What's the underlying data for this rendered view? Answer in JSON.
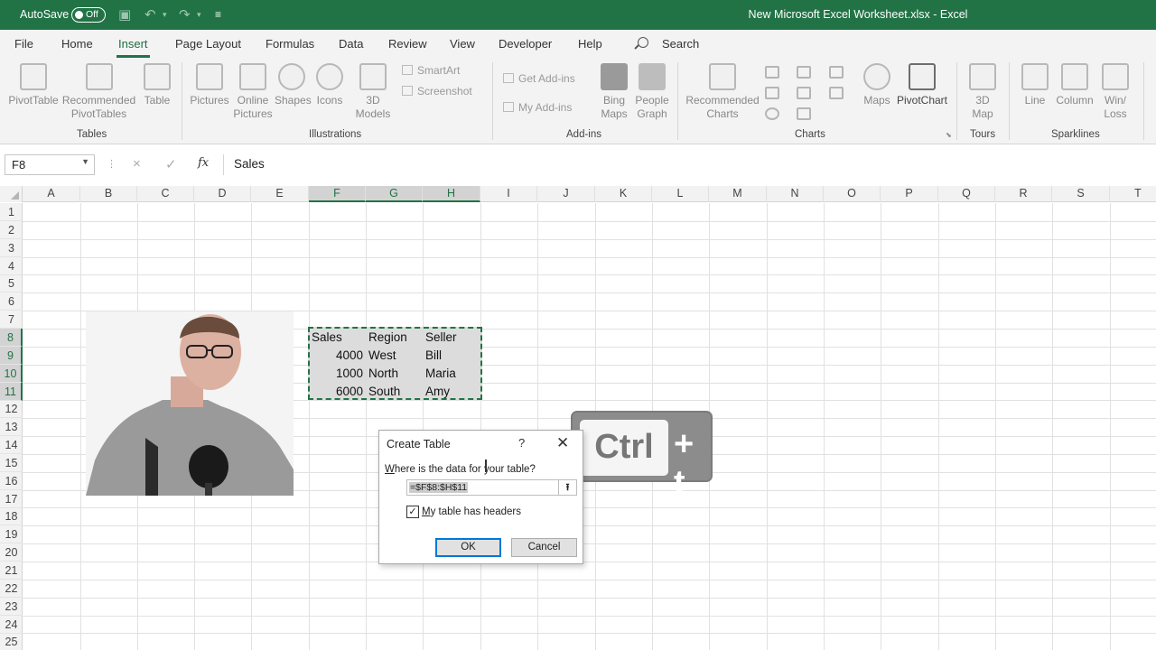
{
  "titlebar": {
    "autosave_label": "AutoSave",
    "autosave_state": "Off",
    "doc_title": "New Microsoft Excel Worksheet.xlsx  -  Excel"
  },
  "tabs": [
    "File",
    "Home",
    "Insert",
    "Page Layout",
    "Formulas",
    "Data",
    "Review",
    "View",
    "Developer",
    "Help"
  ],
  "active_tab": "Insert",
  "search_label": "Search",
  "ribbon": {
    "tables": {
      "label": "Tables",
      "pivottable": "PivotTable",
      "recommended_1": "Recommended",
      "recommended_2": "PivotTables",
      "table": "Table"
    },
    "illustrations": {
      "label": "Illustrations",
      "pictures": "Pictures",
      "online_1": "Online",
      "online_2": "Pictures",
      "shapes": "Shapes",
      "icons": "Icons",
      "models_1": "3D",
      "models_2": "Models",
      "smartart": "SmartArt",
      "screenshot": "Screenshot"
    },
    "addins": {
      "label": "Add-ins",
      "get": "Get Add-ins",
      "my": "My Add-ins",
      "bing_1": "Bing",
      "bing_2": "Maps",
      "people_1": "People",
      "people_2": "Graph"
    },
    "charts": {
      "label": "Charts",
      "rec_1": "Recommended",
      "rec_2": "Charts",
      "maps": "Maps",
      "pivotchart": "PivotChart"
    },
    "tours": {
      "label": "Tours",
      "map_1": "3D",
      "map_2": "Map"
    },
    "sparklines": {
      "label": "Sparklines",
      "line": "Line",
      "column": "Column",
      "winloss_1": "Win/",
      "winloss_2": "Loss"
    }
  },
  "formula_bar": {
    "name_box": "F8",
    "cancel_icon": "×",
    "enter_icon": "✓",
    "fx_label": "fx",
    "value": "Sales"
  },
  "columns": [
    "A",
    "B",
    "C",
    "D",
    "E",
    "F",
    "G",
    "H",
    "I",
    "J",
    "K",
    "L",
    "M",
    "N",
    "O",
    "P",
    "Q",
    "R",
    "S",
    "T"
  ],
  "selected_columns": [
    "F",
    "G",
    "H"
  ],
  "rows": [
    "1",
    "2",
    "3",
    "4",
    "5",
    "6",
    "7",
    "8",
    "9",
    "10",
    "11",
    "12",
    "13",
    "14",
    "15",
    "16",
    "17",
    "18",
    "19",
    "20",
    "21",
    "22",
    "23",
    "24",
    "25"
  ],
  "selected_rows": [
    "8",
    "9",
    "10",
    "11"
  ],
  "table": {
    "headers": [
      "Sales",
      "Region",
      "Seller"
    ],
    "rows": [
      [
        "4000",
        "West",
        "Bill"
      ],
      [
        "1000",
        "North",
        "Maria"
      ],
      [
        "6000",
        "South",
        "Amy"
      ]
    ]
  },
  "shortcut": {
    "key": "Ctrl",
    "plus": "+ t"
  },
  "dialog": {
    "title": "Create Table",
    "help": "?",
    "close": "✕",
    "prompt_accel": "W",
    "prompt_rest": "here is the data for your table?",
    "range": "=$F$8:$H$11",
    "has_headers_accel": "M",
    "has_headers_rest": "y table has headers",
    "has_headers_checked": true,
    "ok": "OK",
    "cancel": "Cancel"
  },
  "colors": {
    "accent": "#217346",
    "dialog_focus": "#0078d7"
  }
}
